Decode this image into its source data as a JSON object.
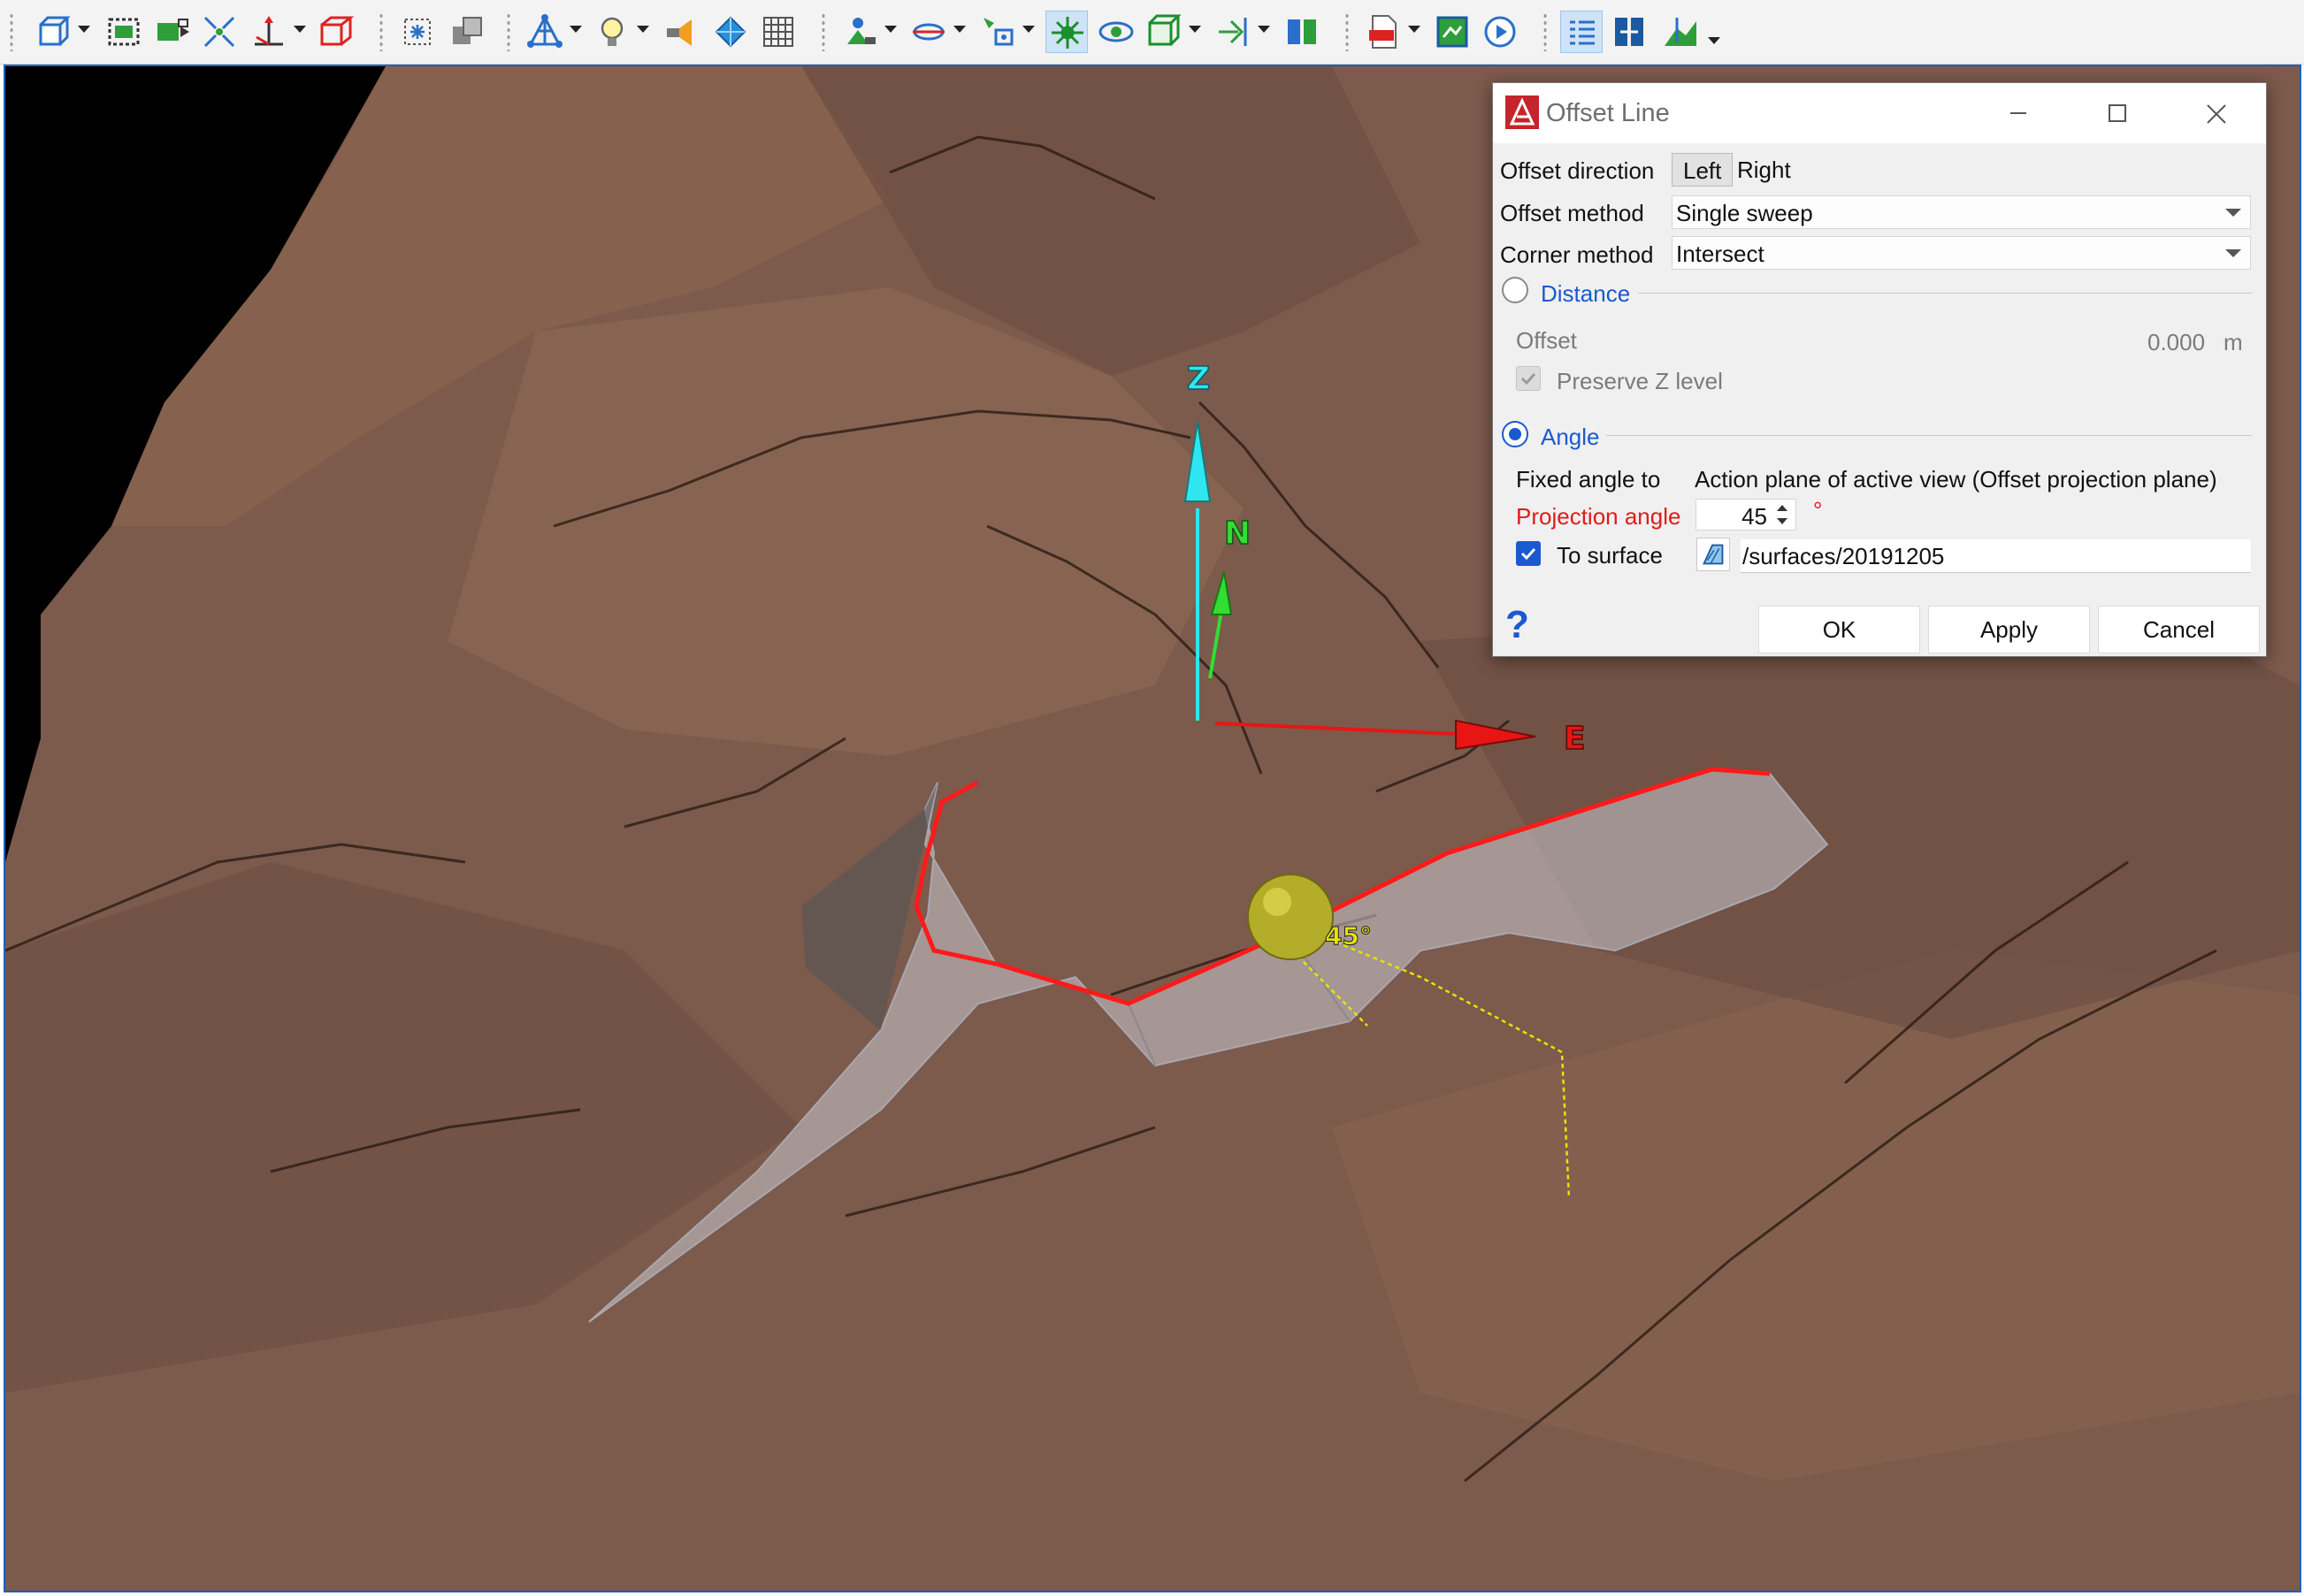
{
  "toolbar": {
    "groups": [
      [
        "view-cube-icon",
        "zoom-extents-icon",
        "zoom-selected-icon",
        "zoom-fit-icon",
        "axis-up-icon",
        "box-view-icon"
      ],
      [
        "snap-point-icon",
        "snap-object-icon"
      ],
      [
        "triangle-network-icon",
        "light-bulb-icon",
        "transparency-icon",
        "color-diamond-icon",
        "grid-icon"
      ],
      [
        "section-icon",
        "plane-icon",
        "select-points-icon",
        "crosshair-icon",
        "orbit-center-icon",
        "box-section-icon",
        "clip-icon",
        "split-view-icon"
      ],
      [
        "pdf-export-icon",
        "map-icon",
        "play-icon"
      ],
      [
        "properties-icon",
        "compare-icon",
        "surface-measure-icon"
      ]
    ]
  },
  "scene": {
    "axes": {
      "z": "Z",
      "n": "N",
      "e": "E"
    },
    "angle_marker": "45°",
    "colors": {
      "terrain": "#7c5a4c",
      "offset_line": "#ff1a1a",
      "offset_surface": "#c9c9cf",
      "guide": "#e6e300"
    }
  },
  "dialog": {
    "title": "Offset Line",
    "offset_direction": {
      "label": "Offset direction",
      "options": [
        "Left",
        "Right"
      ],
      "selected": "Left"
    },
    "offset_method": {
      "label": "Offset method",
      "value": "Single sweep"
    },
    "corner_method": {
      "label": "Corner method",
      "value": "Intersect"
    },
    "distance": {
      "label": "Distance",
      "selected": false,
      "offset_label": "Offset",
      "offset_value": "0.000",
      "unit": "m",
      "preserve_z_label": "Preserve Z level",
      "preserve_z_checked": true
    },
    "angle": {
      "label": "Angle",
      "selected": true,
      "fixed_angle_label": "Fixed angle to",
      "fixed_angle_value": "Action plane of active view (Offset projection plane)",
      "projection_angle_label": "Projection angle",
      "projection_angle_value": "45",
      "degree_symbol": "°",
      "to_surface_label": "To surface",
      "to_surface_checked": true,
      "surface_path": "/surfaces/20191205"
    },
    "help_label": "?",
    "buttons": {
      "ok": "OK",
      "apply": "Apply",
      "cancel": "Cancel"
    }
  }
}
